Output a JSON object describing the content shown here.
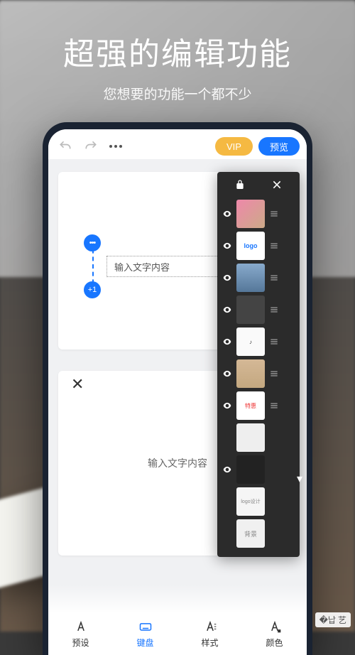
{
  "promo": {
    "title": "超强的编辑功能",
    "subtitle": "您想要的功能一个都不少"
  },
  "toolbar": {
    "vip_label": "VIP",
    "preview_label": "预览"
  },
  "canvas": {
    "text_placeholder_1": "输入文字内容",
    "add_label": "+1",
    "text_placeholder_2": "输入文字内容"
  },
  "layers": {
    "items": [
      {
        "label": ""
      },
      {
        "label": "logo"
      },
      {
        "label": ""
      },
      {
        "label": ""
      },
      {
        "label": "♪"
      },
      {
        "label": ""
      },
      {
        "label": "特惠"
      },
      {
        "label": ""
      },
      {
        "label": ""
      },
      {
        "label": "logo设计"
      },
      {
        "label": "背景"
      }
    ]
  },
  "tabs": {
    "items": [
      {
        "label": "预设"
      },
      {
        "label": "键盘"
      },
      {
        "label": "样式"
      },
      {
        "label": "颜色"
      }
    ]
  },
  "watermark": "艺"
}
